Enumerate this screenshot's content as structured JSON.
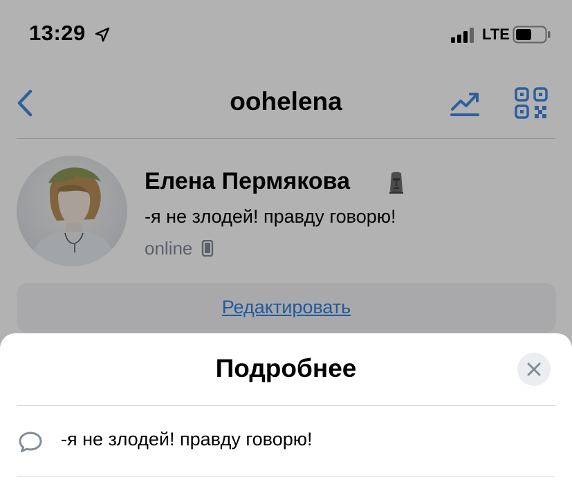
{
  "status_bar": {
    "time": "13:29",
    "network": "LTE",
    "icons": [
      "location-arrow-icon",
      "signal-bars-icon",
      "battery-icon"
    ]
  },
  "nav": {
    "title": "oohelena",
    "icons": [
      "back-chevron-icon",
      "stats-trend-icon",
      "qr-code-icon"
    ]
  },
  "profile": {
    "name": "Елена Пермякова",
    "name_emoji": "moai-icon",
    "status": "-я не злодей! правду говорю!",
    "online": "online",
    "edit_label": "Редактировать"
  },
  "sheet": {
    "title": "Подробнее",
    "rows": [
      {
        "icon": "comment-bubble-icon",
        "text": "-я не злодей! правду говорю!"
      }
    ]
  },
  "colors": {
    "accent": "#2d81e0",
    "icon_blue": "#3f8ae0",
    "secondary_text": "#818c99",
    "overlay": "rgba(0,0,0,0.30)"
  }
}
